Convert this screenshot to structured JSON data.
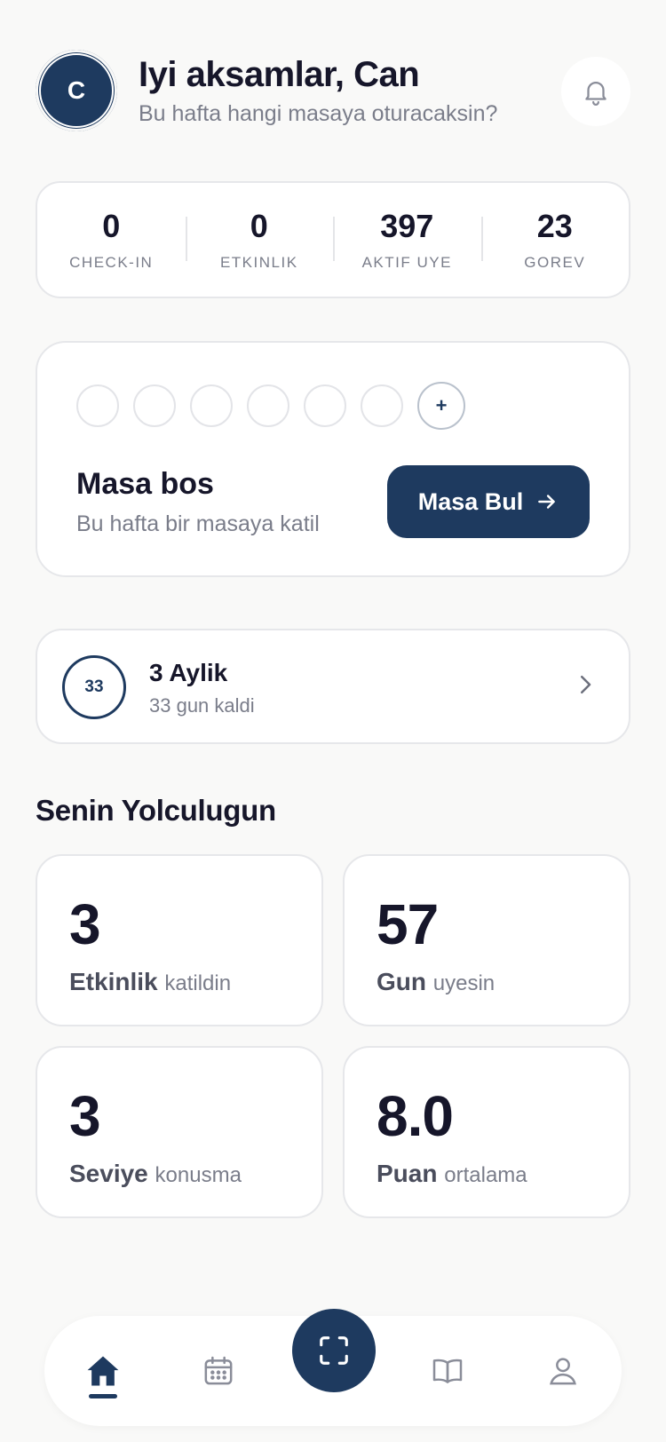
{
  "header": {
    "avatar_initial": "C",
    "greeting": "Iyi aksamlar, Can",
    "subtitle": "Bu hafta hangi masaya oturacaksin?"
  },
  "stats": [
    {
      "value": "0",
      "label": "CHECK-IN"
    },
    {
      "value": "0",
      "label": "ETKINLIK"
    },
    {
      "value": "397",
      "label": "AKTIF UYE"
    },
    {
      "value": "23",
      "label": "GOREV"
    }
  ],
  "table": {
    "add_seat": "+",
    "title": "Masa bos",
    "subtitle": "Bu hafta bir masaya katil",
    "button_label": "Masa Bul"
  },
  "membership": {
    "days": "33",
    "title": "3 Aylik",
    "subtitle": "33 gun kaldi"
  },
  "journey": {
    "title": "Senin Yolculugun",
    "tiles": [
      {
        "value": "3",
        "label": "Etkinlik",
        "suffix": "katildin"
      },
      {
        "value": "57",
        "label": "Gun",
        "suffix": "uyesin"
      },
      {
        "value": "3",
        "label": "Seviye",
        "suffix": "konusma"
      },
      {
        "value": "8.0",
        "label": "Puan",
        "suffix": "ortalama"
      }
    ]
  },
  "nav": {
    "items": [
      "home-icon",
      "calendar-icon",
      "scan-icon",
      "book-icon",
      "profile-icon"
    ],
    "active": "home-icon",
    "accent": "#1e3a5f"
  }
}
